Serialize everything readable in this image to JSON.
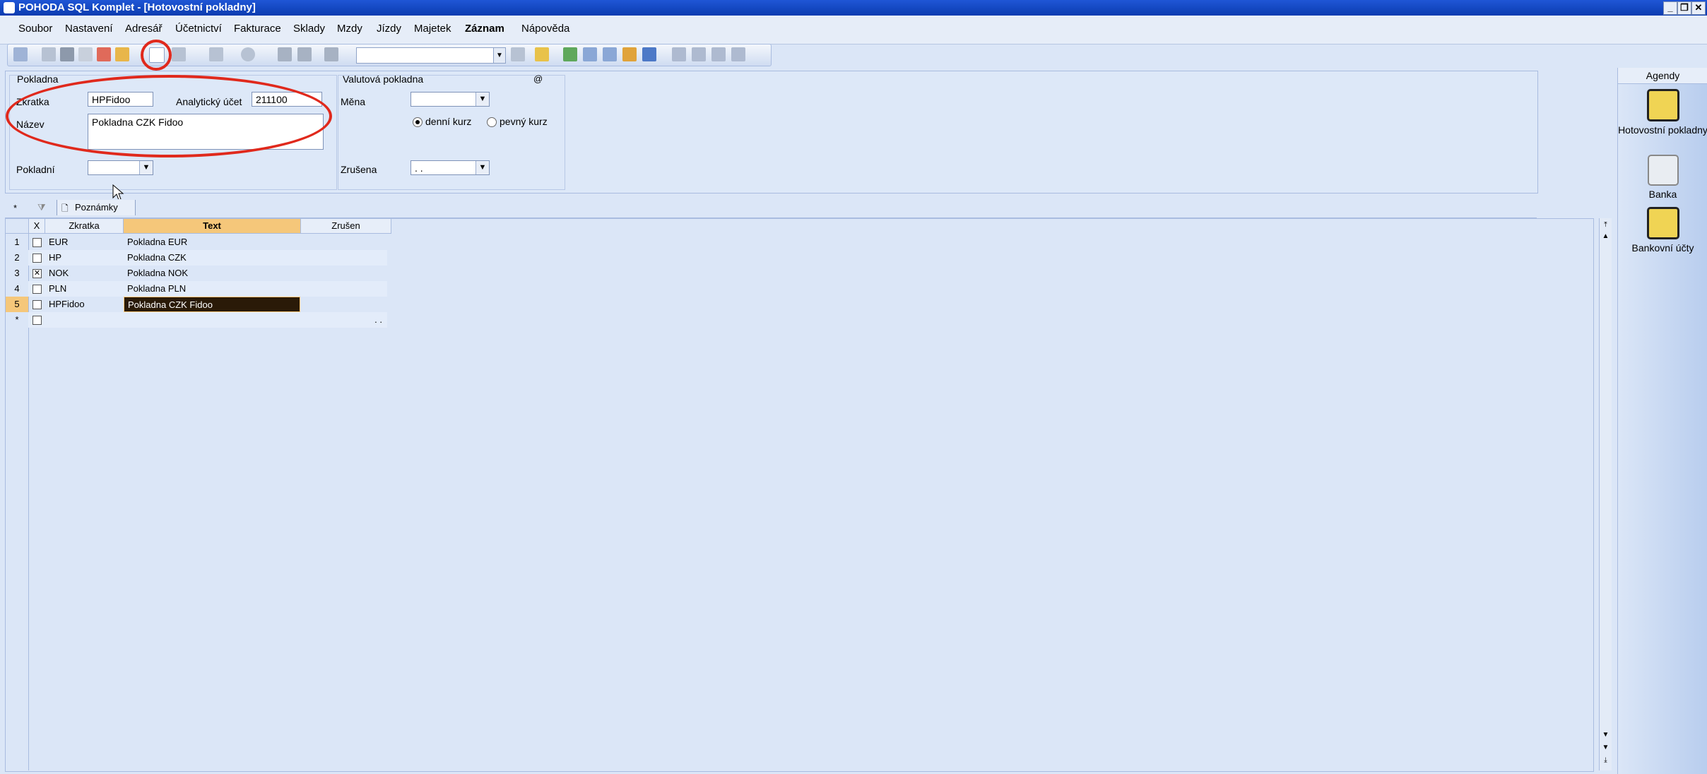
{
  "window": {
    "title": "POHODA SQL Komplet - [Hotovostní pokladny]"
  },
  "menu": [
    "Soubor",
    "Nastavení",
    "Adresář",
    "Účetnictví",
    "Fakturace",
    "Sklady",
    "Mzdy",
    "Jízdy",
    "Majetek",
    "Záznam",
    "Nápověda"
  ],
  "form": {
    "group_title": "Pokladna",
    "zkratka_label": "Zkratka",
    "zkratka_value": "HPFidoo",
    "analyticky_label": "Analytický účet",
    "analyticky_value": "211100",
    "nazev_label": "Název",
    "nazev_value": "Pokladna CZK Fidoo",
    "pokladni_label": "Pokladní",
    "valuta_title": "Valutová pokladna",
    "mena_label": "Měna",
    "denni_kurz": "denní kurz",
    "pevny_kurz": "pevný kurz",
    "zrusena_label": "Zrušena",
    "zrusena_value": ". .",
    "at_sign": "@"
  },
  "tabs": {
    "star": "*",
    "notes": "Poznámky"
  },
  "grid": {
    "headers": {
      "x": "X",
      "zkratka": "Zkratka",
      "text": "Text",
      "zrusen": "Zrušen"
    },
    "rows": [
      {
        "num": "1",
        "checked": false,
        "zkratka": "EUR",
        "text": "Pokladna EUR",
        "zrusen": ""
      },
      {
        "num": "2",
        "checked": false,
        "zkratka": "HP",
        "text": "Pokladna CZK",
        "zrusen": ""
      },
      {
        "num": "3",
        "checked": true,
        "zkratka": "NOK",
        "text": "Pokladna NOK",
        "zrusen": ""
      },
      {
        "num": "4",
        "checked": false,
        "zkratka": "PLN",
        "text": "Pokladna PLN",
        "zrusen": ""
      },
      {
        "num": "5",
        "checked": false,
        "zkratka": "HPFidoo",
        "text": "Pokladna CZK Fidoo",
        "zrusen": "",
        "selected": true
      },
      {
        "num": "*",
        "checked": false,
        "zkratka": "",
        "text": "",
        "zrusen": ". ."
      }
    ]
  },
  "agenda": {
    "title": "Agendy",
    "items": [
      "Hotovostní pokladny",
      "Banka",
      "Bankovní účty"
    ]
  },
  "colors": {
    "accent": "#0b3cb0",
    "annotation": "#e0291c",
    "selected_row": "#f5c77a"
  }
}
